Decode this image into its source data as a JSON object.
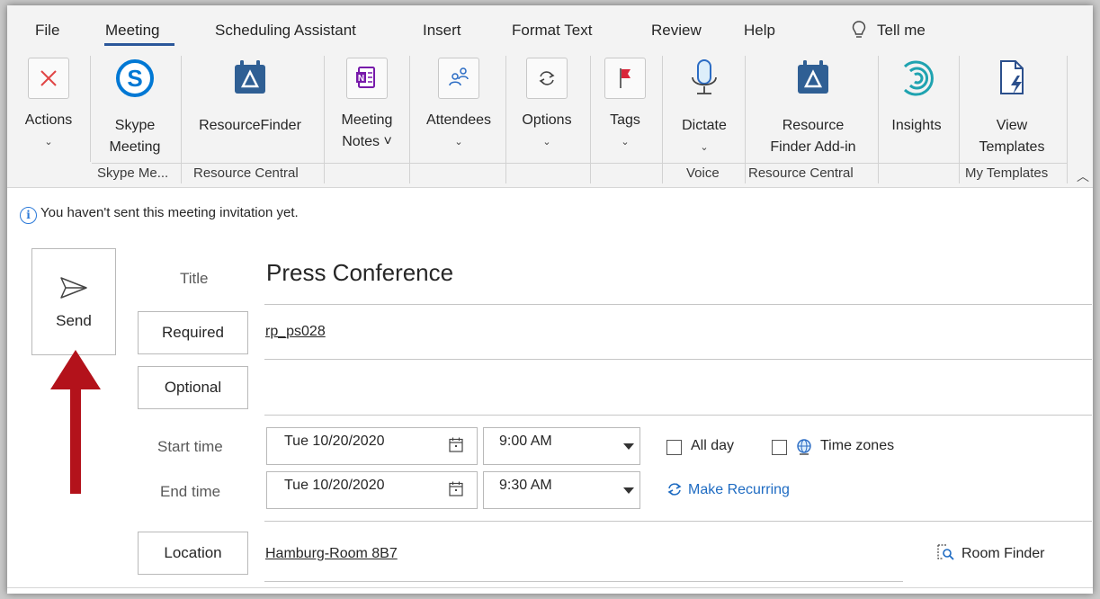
{
  "tabs": [
    "File",
    "Meeting",
    "Scheduling Assistant",
    "Insert",
    "Format Text",
    "Review",
    "Help",
    "Tell me"
  ],
  "ribbon": {
    "actions": {
      "label": "Actions"
    },
    "skype": {
      "line1": "Skype",
      "line2": "Meeting"
    },
    "resource_finder": {
      "label": "ResourceFinder"
    },
    "meeting_notes": {
      "line1": "Meeting",
      "line2": "Notes ˅"
    },
    "attendees": {
      "label": "Attendees"
    },
    "options": {
      "label": "Options"
    },
    "tags": {
      "label": "Tags"
    },
    "dictate": {
      "label": "Dictate"
    },
    "rf_addin": {
      "line1": "Resource",
      "line2": "Finder Add-in"
    },
    "insights": {
      "label": "Insights"
    },
    "view_templates": {
      "line1": "View",
      "line2": "Templates"
    },
    "groups": {
      "skype": "Skype Me...",
      "resource_central_1": "Resource Central",
      "voice": "Voice",
      "resource_central_2": "Resource Central",
      "my_templates": "My Templates"
    }
  },
  "info_bar": "You haven't sent this meeting invitation yet.",
  "send": {
    "label": "Send"
  },
  "form": {
    "title_label": "Title",
    "title_value": "Press Conference",
    "required_label": "Required",
    "required_value": "rp_ps028",
    "optional_label": "Optional",
    "start_label": "Start time",
    "start_date": "Tue 10/20/2020",
    "start_time": "9:00 AM",
    "end_label": "End time",
    "end_date": "Tue 10/20/2020",
    "end_time": "9:30 AM",
    "all_day": "All day",
    "time_zones": "Time zones",
    "make_recurring": "Make Recurring",
    "location_label": "Location",
    "location_value": "Hamburg-Room 8B7",
    "room_finder": "Room Finder"
  },
  "colors": {
    "accent": "#2b579a",
    "link_blue": "#1e6bc2",
    "arrow_red": "#b3121b",
    "skype_blue": "#0078d4",
    "onenote_purple": "#7719aa"
  }
}
